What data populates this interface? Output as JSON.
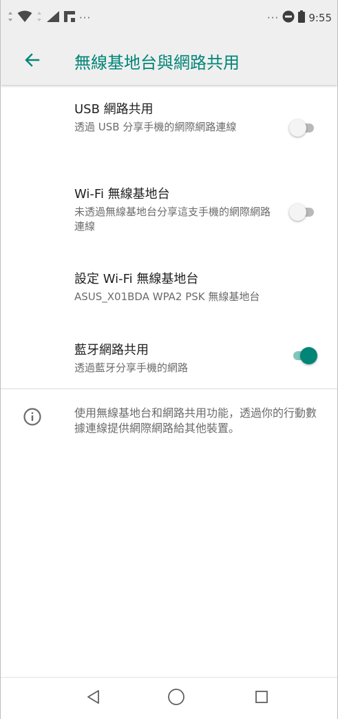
{
  "status_bar": {
    "left_overflow": "···",
    "right_overflow": "···",
    "time": "9:55",
    "icons": [
      "data-arrows-icon",
      "wifi-icon",
      "signal-icon",
      "flipboard-icon",
      "dnd-icon",
      "battery-icon"
    ]
  },
  "app_bar": {
    "title": "無線基地台與網路共用",
    "back_icon": "arrow-left-icon"
  },
  "preferences": [
    {
      "title": "USB 網路共用",
      "summary": "透過 USB 分享手機的網際網路連線",
      "switch_on": false
    },
    {
      "title": "Wi-Fi 無線基地台",
      "summary": "未透過無線基地台分享這支手機的網際網路連線",
      "switch_on": false
    },
    {
      "title": "設定 Wi-Fi 無線基地台",
      "summary": "ASUS_X01BDA WPA2 PSK 無線基地台"
    },
    {
      "title": "藍牙網路共用",
      "summary": "透過藍牙分享手機的網路",
      "switch_on": true
    }
  ],
  "footer_info": {
    "icon": "info-icon",
    "text": "使用無線基地台和網路共用功能，透過你的行動數據連線提供網際網路給其他裝置。"
  },
  "nav_bar": {
    "icons": [
      "back-triangle-icon",
      "home-circle-icon",
      "recents-square-icon"
    ]
  },
  "colors": {
    "accent": "#008577",
    "accent_track": "#80c6bd",
    "bar_background": "#efefef"
  }
}
